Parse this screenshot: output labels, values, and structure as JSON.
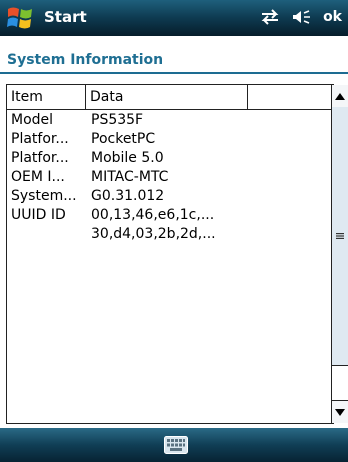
{
  "titlebar": {
    "title": "Start",
    "ok_label": "ok",
    "icons": [
      "windows-start-icon",
      "connectivity-icon",
      "volume-icon"
    ]
  },
  "header": {
    "title": "System Information"
  },
  "table": {
    "columns": [
      "Item",
      "Data",
      ""
    ],
    "rows": [
      {
        "item": "Model",
        "data": "PS535F"
      },
      {
        "item": "Platfor...",
        "data": "PocketPC"
      },
      {
        "item": "Platfor...",
        "data": "Mobile 5.0"
      },
      {
        "item": "OEM I...",
        "data": "MITAC-MTC"
      },
      {
        "item": "System...",
        "data": "G0.31.012"
      },
      {
        "item": "UUID ID",
        "data": "00,13,46,e6,1c,..."
      },
      {
        "item": "",
        "data": "30,d4,03,2b,2d,..."
      }
    ]
  },
  "bottombar": {
    "keyboard_icon": "keyboard-icon"
  },
  "colors": {
    "titlebar": "#0e3a50",
    "header_text": "#1f6f93",
    "header_border": "#1d6c92"
  }
}
